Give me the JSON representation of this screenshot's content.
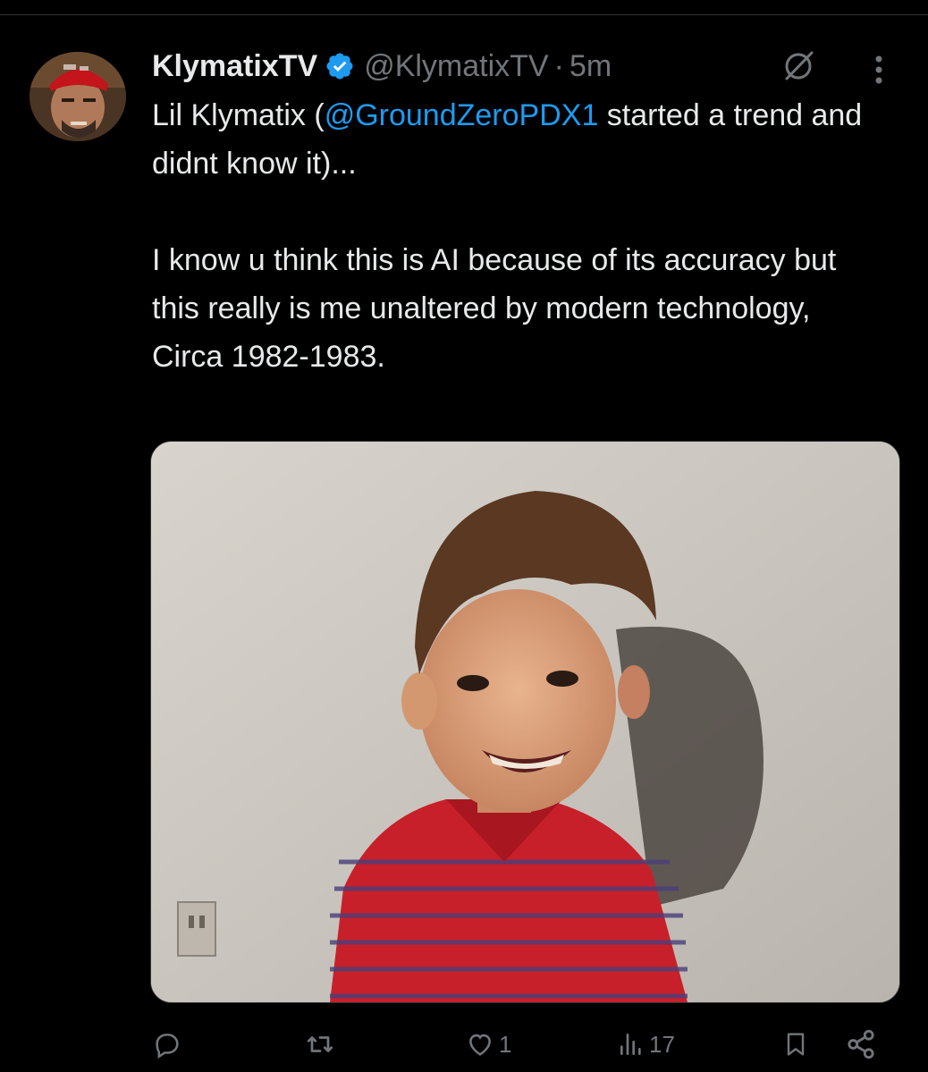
{
  "tweet": {
    "display_name": "KlymatixTV",
    "handle": "@KlymatixTV",
    "separator": "·",
    "time": "5m",
    "text_line1_prefix": "Lil Klymatix (",
    "text_mention": "@GroundZeroPDX1",
    "text_line1_suffix": " started a trend and didnt know it)...",
    "text_paragraph2": "I know u think this is AI because of its accuracy but this really is me unaltered by modern technology,",
    "text_paragraph3": "Circa 1982-1983."
  },
  "actions": {
    "reply_count": "",
    "repost_count": "",
    "like_count": "1",
    "views_count": "17"
  },
  "icons": {
    "verified": "verified-badge-icon",
    "grok": "grok-icon",
    "more": "more-icon",
    "reply": "reply-icon",
    "repost": "repost-icon",
    "like": "heart-icon",
    "views": "views-icon",
    "bookmark": "bookmark-icon",
    "share": "share-icon"
  },
  "colors": {
    "background": "#000000",
    "text": "#e7e9ea",
    "secondary": "#71767b",
    "link": "#1d9bf0",
    "verified": "#1d9bf0"
  }
}
